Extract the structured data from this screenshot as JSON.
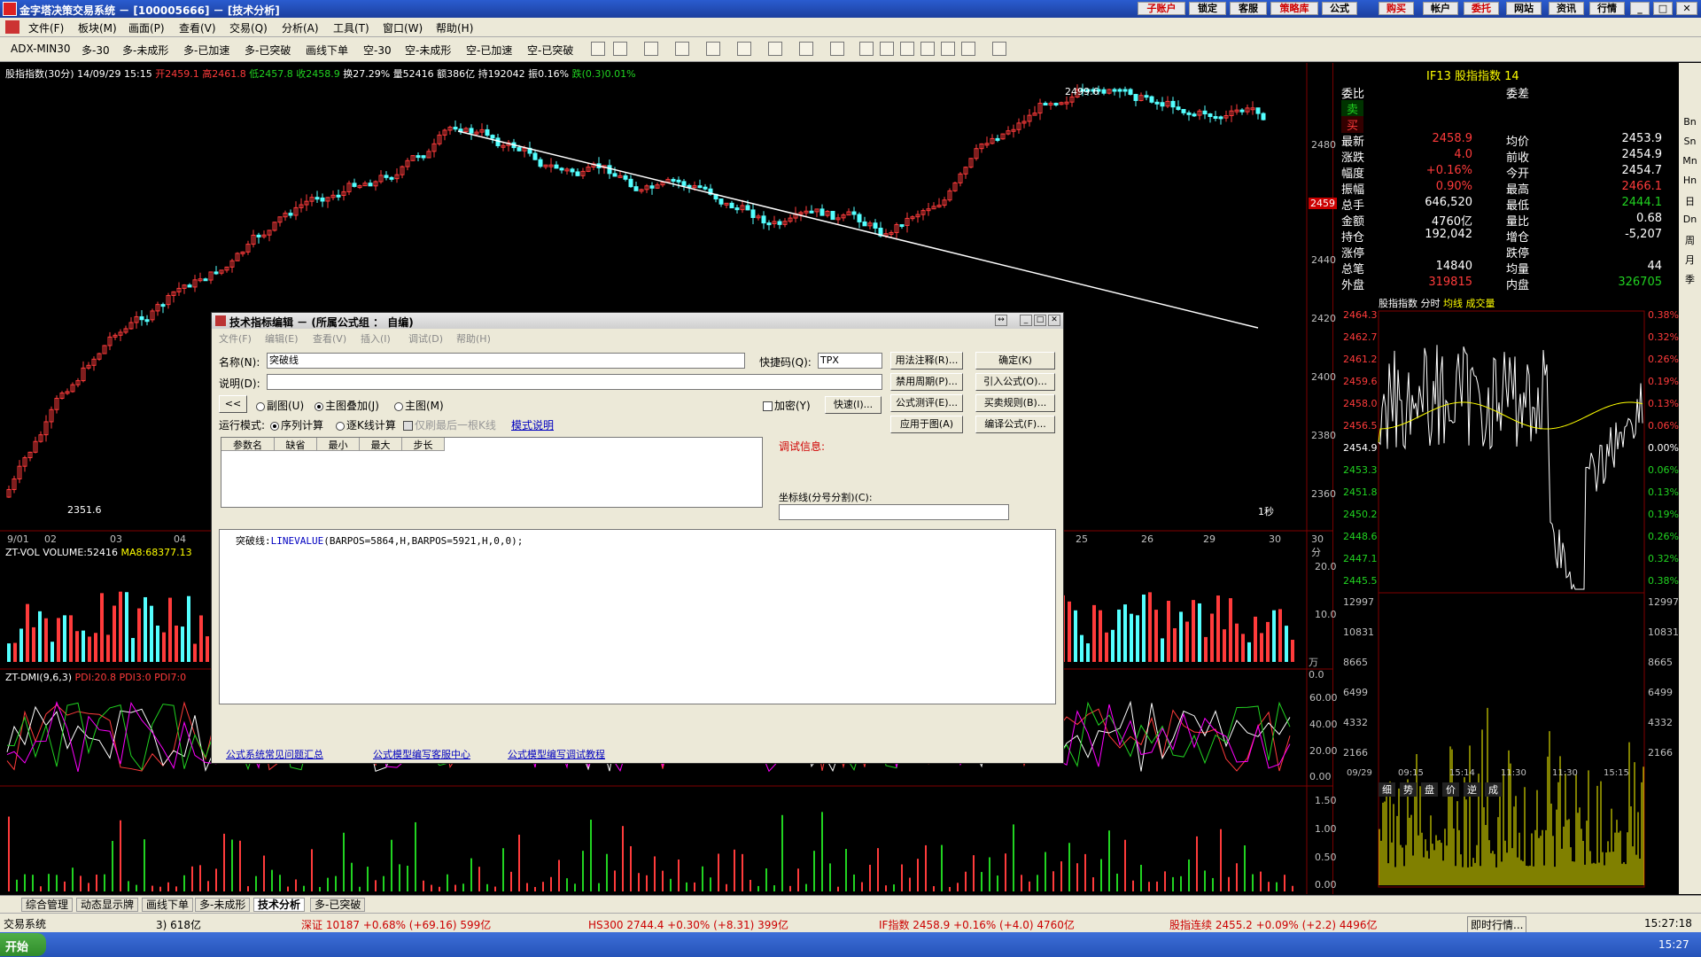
{
  "window": {
    "title": "金字塔决策交易系统 － [100005666] － [技术分析]",
    "top_buttons": [
      "子账户",
      "锁定",
      "客服",
      "策略库",
      "公式",
      "购买",
      "帐户",
      "委托",
      "网站",
      "资讯",
      "行情"
    ]
  },
  "menu": [
    "文件(F)",
    "板块(M)",
    "画面(P)",
    "查看(V)",
    "交易(Q)",
    "分析(A)",
    "工具(T)",
    "窗口(W)",
    "帮助(H)"
  ],
  "toolbar": [
    "ADX-MIN30",
    "多-30",
    "多-未成形",
    "多-已加速",
    "多-已突破",
    "画线下单",
    "空-30",
    "空-未成形",
    "空-已加速",
    "空-已突破"
  ],
  "main_header": {
    "name": "股指指数",
    "period": "(30分)",
    "date": "14/09/29 15:15",
    "open": "开2459.1",
    "high": "高2461.8",
    "low": "低2457.8",
    "close": "收2458.9",
    "turnover": "换27.29%",
    "volume": "量52416",
    "amount": "额386亿",
    "hold": "持192042",
    "amplitude": "振0.16%",
    "change": "跌(0.3)0.01%"
  },
  "price_axis": [
    "2480",
    "2460",
    "2440",
    "2420",
    "2400",
    "2380",
    "2360"
  ],
  "price_marks": {
    "high": "2499.6",
    "low": "2351.6",
    "current": "2459"
  },
  "date_axis": [
    "9/01",
    "02",
    "03",
    "04",
    "25",
    "26",
    "29",
    "30"
  ],
  "period_label": "30分",
  "second_label": "1秒",
  "vol_header": {
    "name": "ZT-VOL",
    "volume": "VOLUME:52416",
    "ma": "MA8:68377.13"
  },
  "vol_axis": [
    "20.0",
    "10.0",
    "万 0.0"
  ],
  "dmi_header": {
    "name": "ZT-DMI(9,6,3)",
    "pdi": "PDI:20.8",
    "pdi3": "PDI3:0",
    "pdi7": "PDI7:0"
  },
  "dmi_axis": [
    "60.00",
    "40.00",
    "20.00",
    "0.00"
  ],
  "bottom_axis": [
    "1.50",
    "1.00",
    "0.50",
    "0.00"
  ],
  "dialog": {
    "title": "技术指标编辑 － (所属公式组 ： 自编)",
    "menu": [
      "文件(F)",
      "编辑(E)",
      "查看(V)",
      "插入(I)",
      "调试(D)",
      "帮助(H)"
    ],
    "name_label": "名称(N):",
    "name_value": "突破线",
    "hotkey_label": "快捷码(Q):",
    "hotkey_value": "TPX",
    "desc_label": "说明(D):",
    "desc_value": "",
    "prev_btn": "<<",
    "radio_sub": "副图(U)",
    "radio_main_overlay": "主图叠加(J)",
    "radio_main": "主图(M)",
    "encrypt": "加密(Y)",
    "quick_btn": "快速(I)...",
    "run_mode_label": "运行模式:",
    "run_seq": "序列计算",
    "run_step": "逐K线计算",
    "only_last": "仅刷最后一根K线",
    "mode_help": "模式说明",
    "param_headers": [
      "参数名",
      "缺省",
      "最小",
      "最大",
      "步长"
    ],
    "debug_label": "调试信息:",
    "coord_label": "坐标线(分号分割)(C):",
    "buttons_right": [
      "用法注释(R)...",
      "确定(K)",
      "禁用周期(P)...",
      "引入公式(O)...",
      "公式测评(E)...",
      "买卖规则(B)...",
      "应用于图(A)",
      "编译公式(F)..."
    ],
    "code": {
      "label": "突破线:",
      "fn": "LINEVALUE",
      "args": "(BARPOS=5864,H,BARPOS=5921,H,0,0);"
    },
    "links": [
      "公式系统常见问题汇总",
      "公式模型编写客服中心",
      "公式模型编写调试教程"
    ]
  },
  "right_panel": {
    "title": "IF13  股指指数 14",
    "rows": [
      {
        "k": "委比",
        "v1": "",
        "k2": "委差",
        "v2": ""
      },
      {
        "k": "卖",
        "v1": "",
        "k2": "",
        "v2": ""
      },
      {
        "k": "买",
        "v1": "",
        "k2": "",
        "v2": ""
      },
      {
        "k": "最新",
        "v1": "2458.9",
        "k2": "均价",
        "v2": "2453.9"
      },
      {
        "k": "涨跌",
        "v1": "4.0",
        "k2": "前收",
        "v2": "2454.9"
      },
      {
        "k": "幅度",
        "v1": "+0.16%",
        "k2": "今开",
        "v2": "2454.7"
      },
      {
        "k": "振幅",
        "v1": "0.90%",
        "k2": "最高",
        "v2": "2466.1"
      },
      {
        "k": "总手",
        "v1": "646,520",
        "k2": "最低",
        "v2": "2444.1"
      },
      {
        "k": "金额",
        "v1": "4760亿",
        "k2": "量比",
        "v2": "0.68"
      },
      {
        "k": "持仓",
        "v1": "192,042",
        "k2": "增仓",
        "v2": "-5,207"
      },
      {
        "k": "涨停",
        "v1": "",
        "k2": "跌停",
        "v2": ""
      },
      {
        "k": "总笔",
        "v1": "14840",
        "k2": "均量",
        "v2": "44"
      },
      {
        "k": "外盘",
        "v1": "319815",
        "k2": "内盘",
        "v2": "326705"
      }
    ],
    "intraday_header": [
      "股指指数",
      "分时",
      "均线",
      "成交量"
    ],
    "price_left": [
      "2464.3",
      "2462.7",
      "2461.2",
      "2459.6",
      "2458.0",
      "2456.5",
      "2454.9",
      "2453.3",
      "2451.8",
      "2450.2",
      "2448.6",
      "2447.1",
      "2445.5"
    ],
    "pct_right": [
      "0.38%",
      "0.32%",
      "0.26%",
      "0.19%",
      "0.13%",
      "0.06%",
      "0.00%",
      "0.06%",
      "0.13%",
      "0.19%",
      "0.26%",
      "0.32%",
      "0.38%"
    ],
    "vol_left": [
      "12997",
      "10831",
      "8665",
      "6499",
      "4332",
      "2166"
    ],
    "time_axis": [
      "09/29",
      "09:15",
      "15:14",
      "11:30",
      "11:30",
      "15:15"
    ],
    "bottom_tabs": [
      "细",
      "势",
      "盘",
      "价",
      "逆",
      "成"
    ]
  },
  "right_strip": [
    "Bn",
    "Sn",
    "Mn",
    "Hn",
    "日",
    "Dn",
    "周",
    "月",
    "季"
  ],
  "bottom_tabs": [
    "综合管理",
    "动态显示牌",
    "画线下单",
    "多-未成形",
    "技术分析",
    "多-已突破"
  ],
  "ticker": {
    "left": "交易系统",
    "items": [
      "3) 618亿",
      "深证 10187 +0.68% (+69.16) 599亿",
      "HS300 2744.4 +0.30% (+8.31) 399亿",
      "IF指数 2458.9 +0.16% (+4.0) 4760亿",
      "股指连续 2455.2 +0.09% (+2.2) 4496亿"
    ],
    "realtime": "即时行情...",
    "time": "15:27:18"
  },
  "taskbar": {
    "start": "开始",
    "clock": "15:27"
  }
}
